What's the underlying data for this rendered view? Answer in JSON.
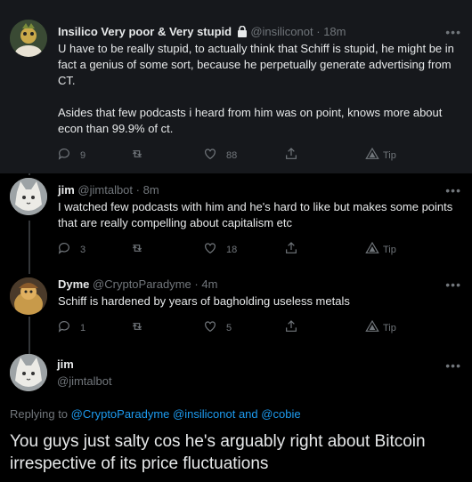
{
  "tweets": [
    {
      "name": "Insilico Very poor & Very stupid",
      "handle": "@insiliconot",
      "time": "18m",
      "text": "U have to be really stupid, to actually think that Schiff is stupid, he might be in fact a genius of some sort, because he perpetually generate advertising from CT.\n\nAsides that few podcasts i heard from him was on point, knows more about econ than 99.9% of ct.",
      "replies": "9",
      "retweets": "",
      "likes": "88",
      "tip_label": "Tip"
    },
    {
      "name": "jim",
      "handle": "@jimtalbot",
      "time": "8m",
      "text": "I watched few podcasts with him and he's hard to like but makes some points that are really compelling about capitalism etc",
      "replies": "3",
      "retweets": "",
      "likes": "18",
      "tip_label": "Tip"
    },
    {
      "name": "Dyme",
      "handle": "@CryptoParadyme",
      "time": "4m",
      "text": "Schiff is hardened by years of bagholding useless metals",
      "replies": "1",
      "retweets": "",
      "likes": "5",
      "tip_label": "Tip"
    }
  ],
  "main_tweet": {
    "name": "jim",
    "handle": "@jimtalbot",
    "replying_prefix": "Replying to",
    "replying_users": [
      "@CryptoParadyme",
      "@insiliconot",
      "@cobie"
    ],
    "replying_and": "and",
    "text": "You guys just salty cos he's arguably right about Bitcoin irrespective of its price fluctuations"
  },
  "common": {
    "dot": "·",
    "more": "•••"
  },
  "icons": {
    "reply": "reply-icon",
    "retweet": "retweet-icon",
    "like": "heart-icon",
    "share": "share-icon",
    "tip": "tip-icon",
    "lock": "lock-icon"
  },
  "colors": {
    "background": "#000000",
    "highlight_background": "#16181c",
    "text": "#e7e9ea",
    "muted": "#71767b",
    "link": "#1d9bf0"
  }
}
